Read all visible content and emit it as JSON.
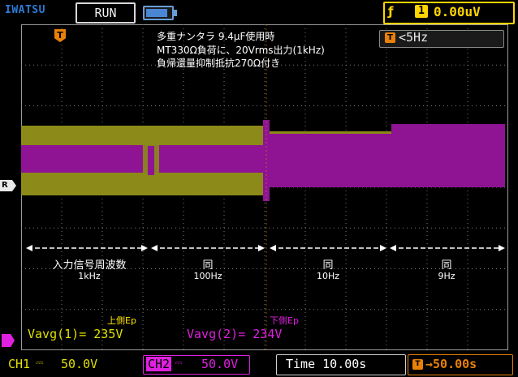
{
  "header": {
    "brand": "IWATSU",
    "run_status": "RUN",
    "trigger_source": "1",
    "trigger_level": "0.00uV"
  },
  "trigger": {
    "marker_label": "T",
    "freq_icon": "T",
    "frequency_text": "<5Hz"
  },
  "markers": {
    "ref": "R"
  },
  "notes": [
    "多重ナンタラ 9.4μF使用時",
    "MT330Ω負荷に、20Vrms出力(1kHz)",
    "負帰還量抑制抵抗270Ω付き"
  ],
  "segments": [
    {
      "title": "入力信号周波数",
      "sub": "1kHz"
    },
    {
      "title": "同",
      "sub": "100Hz"
    },
    {
      "title": "同",
      "sub": "10Hz"
    },
    {
      "title": "同",
      "sub": "9Hz"
    }
  ],
  "labels": {
    "upper": "上側Ep",
    "lower": "下側Ep"
  },
  "measurements": {
    "ch1": "Vavg(1)= 235V",
    "ch2": "Vavg(2)= 234V"
  },
  "footer": {
    "ch1_label": "CH1",
    "ch1_coupling": "⎓",
    "ch1_scale": "50.0V",
    "ch2_label": "CH2",
    "ch2_coupling": "⎓",
    "ch2_scale": "50.0V",
    "timebase": "Time 10.00s",
    "delay_icon": "T",
    "delay": "→50.00s"
  },
  "colors": {
    "ch1": "#8c8a18",
    "ch2": "#8e1494",
    "trigger": "#ffd400",
    "orange": "#e8800a",
    "grid": "#7a7a7a"
  }
}
